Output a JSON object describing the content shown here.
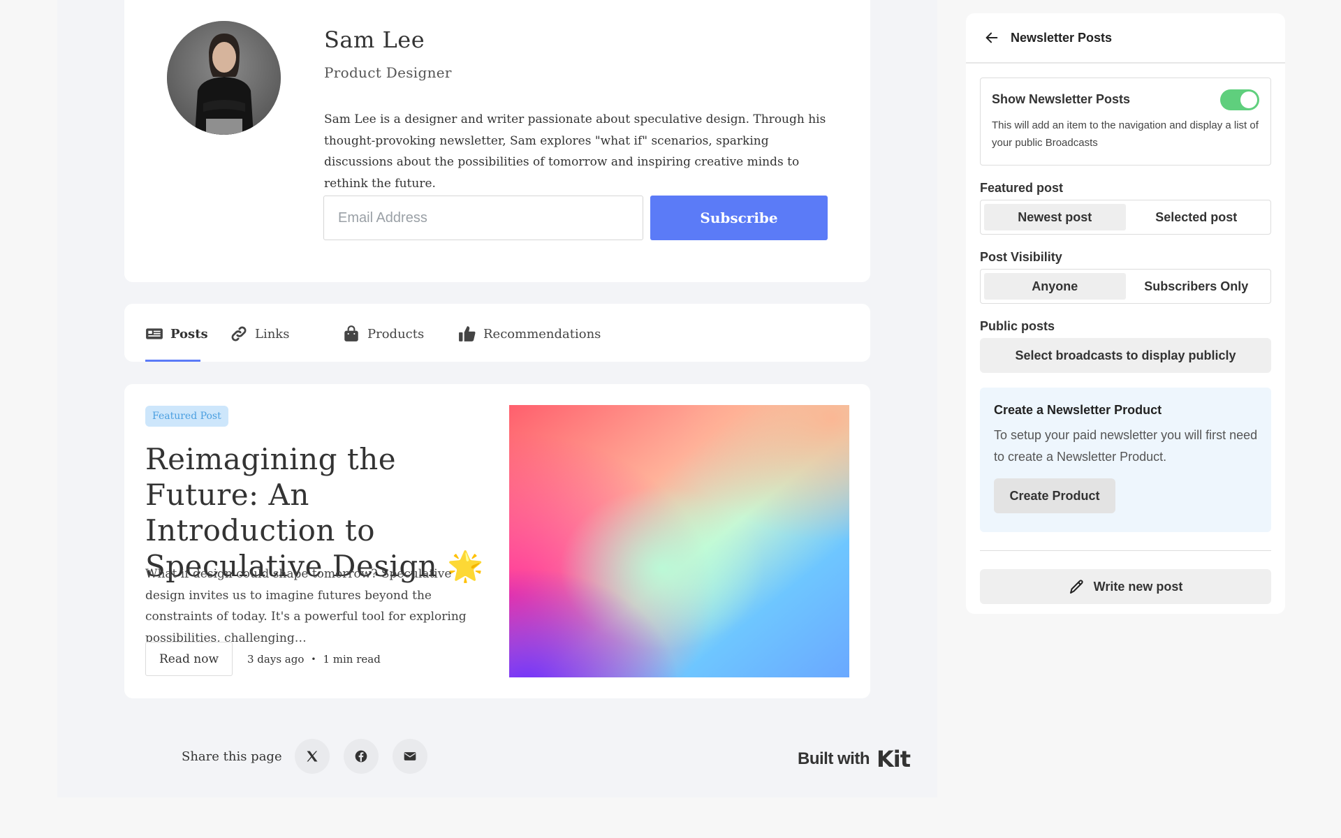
{
  "profile": {
    "name": "Sam Lee",
    "role": "Product Designer",
    "bio": "Sam Lee is a designer and writer passionate about speculative design. Through his thought-provoking newsletter, Sam explores \"what if\" scenarios, sparking discussions about the possibilities of tomorrow and inspiring creative minds to rethink the future.",
    "email_placeholder": "Email Address",
    "subscribe_label": "Subscribe"
  },
  "tabs": [
    {
      "label": "Posts",
      "icon": "newspaper-icon",
      "active": true
    },
    {
      "label": "Links",
      "icon": "link-icon"
    },
    {
      "label": "Products",
      "icon": "bag-icon"
    },
    {
      "label": "Recommendations",
      "icon": "thumbs-up-icon"
    }
  ],
  "featured_post": {
    "badge": "Featured Post",
    "title": "Reimagining the Future: An Introduction to Speculative Design 🌟",
    "excerpt": "What if design could shape tomorrow? Speculative design invites us to imagine futures beyond the constraints of today. It's a powerful tool for exploring possibilities, challenging…",
    "read_label": "Read now",
    "age": "3 days ago",
    "read_time": "1 min read"
  },
  "footer": {
    "share_label": "Share this page",
    "share_icons": [
      "x-icon",
      "facebook-icon",
      "email-icon"
    ],
    "built_with": "Built with",
    "brand": "Kit"
  },
  "panel": {
    "title": "Newsletter Posts",
    "toggle_label": "Show Newsletter Posts",
    "toggle_on": true,
    "toggle_desc": "This will add an item to the navigation and display a list of your public Broadcasts",
    "featured_label": "Featured post",
    "featured_options": [
      "Newest post",
      "Selected post"
    ],
    "visibility_label": "Post Visibility",
    "visibility_options": [
      "Anyone",
      "Subscribers Only"
    ],
    "public_label": "Public posts",
    "public_button": "Select broadcasts to display publicly",
    "product_title": "Create a Newsletter Product",
    "product_desc": "To setup your paid newsletter you will first need to create a Newsletter Product.",
    "create_button": "Create Product",
    "write_button": "Write new post"
  },
  "colors": {
    "accent": "#5b7bf7",
    "toggle": "#5fcf7d",
    "badge_bg": "#cde6fb",
    "badge_text": "#4b9fe0"
  }
}
